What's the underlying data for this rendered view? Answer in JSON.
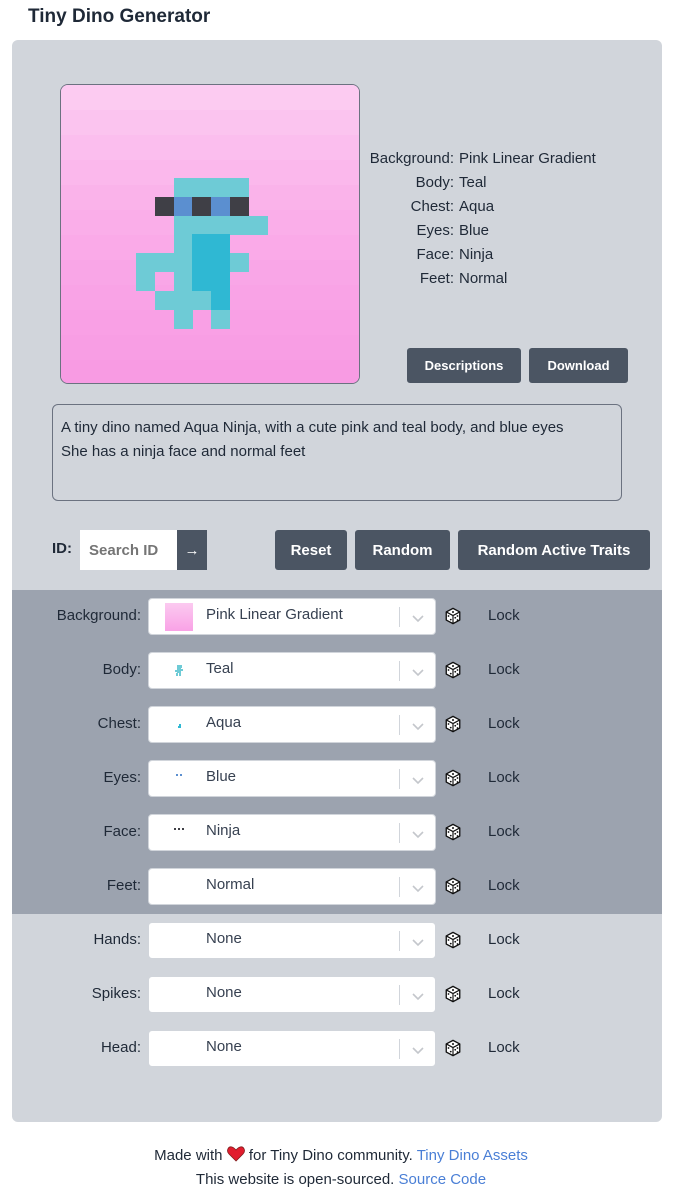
{
  "app": {
    "title": "Tiny Dino Generator"
  },
  "traits_summary": [
    {
      "key": "Background:",
      "value": "Pink Linear Gradient"
    },
    {
      "key": "Body:",
      "value": "Teal"
    },
    {
      "key": "Chest:",
      "value": "Aqua"
    },
    {
      "key": "Eyes:",
      "value": "Blue"
    },
    {
      "key": "Face:",
      "value": "Ninja"
    },
    {
      "key": "Feet:",
      "value": "Normal"
    }
  ],
  "buttons": {
    "descriptions": "Descriptions",
    "download": "Download",
    "reset": "Reset",
    "random": "Random",
    "random_active": "Random Active Traits",
    "go_arrow": "→"
  },
  "description": {
    "line1": "A tiny dino named Aqua Ninja, with a cute pink and teal body, and blue eyes",
    "line2": "She has a ninja face and normal feet"
  },
  "search": {
    "label": "ID:",
    "placeholder": "Search ID"
  },
  "trait_rows": [
    {
      "label": "Background:",
      "value": "Pink Linear Gradient",
      "lock": "Lock",
      "thumb": "pink-gradient-swatch",
      "active": true
    },
    {
      "label": "Body:",
      "value": "Teal",
      "lock": "Lock",
      "thumb": "teal-body-icon",
      "active": true
    },
    {
      "label": "Chest:",
      "value": "Aqua",
      "lock": "Lock",
      "thumb": "aqua-chest-icon",
      "active": true
    },
    {
      "label": "Eyes:",
      "value": "Blue",
      "lock": "Lock",
      "thumb": "blue-eyes-icon",
      "active": true
    },
    {
      "label": "Face:",
      "value": "Ninja",
      "lock": "Lock",
      "thumb": "ninja-face-icon",
      "active": true
    },
    {
      "label": "Feet:",
      "value": "Normal",
      "lock": "Lock",
      "thumb": "",
      "active": true
    },
    {
      "label": "Hands:",
      "value": "None",
      "lock": "Lock",
      "thumb": "",
      "active": false
    },
    {
      "label": "Spikes:",
      "value": "None",
      "lock": "Lock",
      "thumb": "",
      "active": false
    },
    {
      "label": "Head:",
      "value": "None",
      "lock": "Lock",
      "thumb": "",
      "active": false
    }
  ],
  "footer": {
    "made_with": "Made with",
    "for_text": "for Tiny Dino community.",
    "assets_link": "Tiny Dino Assets",
    "open_source": "This website is open-sourced.",
    "source_link": "Source Code"
  },
  "colors": {
    "panel": "#d1d5db",
    "active_band": "#9ca3af",
    "button": "#4b5563",
    "link": "#4a7fd6",
    "dino_teal": "#6ecbd6",
    "dino_aqua": "#2fb8d3",
    "eyes_blue": "#5b8fd0",
    "mask_dark": "#3f3f46"
  }
}
